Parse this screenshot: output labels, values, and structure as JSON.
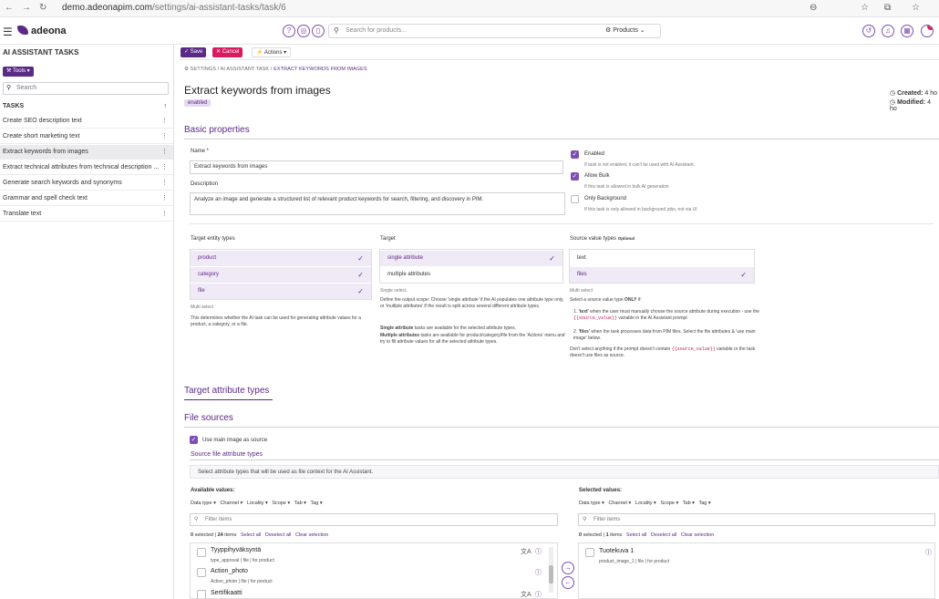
{
  "browser": {
    "url_domain": "demo.adeonapim.com",
    "url_path": "/settings/ai-assistant-tasks/task/6"
  },
  "header": {
    "brand": "adeona",
    "search_placeholder": "Search for products...",
    "search_scope": "Products",
    "notification_count": "6"
  },
  "sidebar": {
    "title": "AI ASSISTANT TASKS",
    "tools_label": "Tools",
    "search_placeholder": "Search",
    "tasks_header": "TASKS",
    "tasks": [
      "Create SEO description text",
      "Create short marketing text",
      "Extract keywords from images",
      "Extract technical attributes from technical description ...",
      "Generate search keywords and synonyms",
      "Grammar and spell check text",
      "Translate text"
    ]
  },
  "toolbar": {
    "save": "Save",
    "cancel": "Cancel",
    "actions": "Actions"
  },
  "breadcrumb": {
    "settings": "SETTINGS",
    "sep": "/",
    "ai": "AI ASSISTANT TASK",
    "current": "EXTRACT KEYWORDS FROM IMAGES"
  },
  "page": {
    "title": "Extract keywords from images",
    "status": "enabled",
    "created_label": "Created:",
    "created_value": "4 ho",
    "modified_label": "Modified:",
    "modified_value": "4 ho"
  },
  "basic": {
    "section_title": "Basic properties",
    "name_label": "Name *",
    "name_value": "Extract keywords from images",
    "desc_label": "Description",
    "desc_value": "Analyze an image and generate a structured list of relevant product keywords for search, filtering, and discovery in PIM.",
    "enabled_label": "Enabled",
    "enabled_hint": "If task is not enabled, it can't be used with AI Assistant.",
    "bulk_label": "Allow Bulk",
    "bulk_hint": "If this task is allowed in bulk AI generation",
    "bg_label": "Only Background",
    "bg_hint": "If this task is only allowed in background jobs, not via UI"
  },
  "target_entity": {
    "label": "Target entity types",
    "options": [
      "product",
      "category",
      "file"
    ],
    "mode": "Multi select",
    "help": "This determines whether the AI task can be used for generating attribute values for a product, a category, or a file."
  },
  "target": {
    "label": "Target",
    "options": [
      "single attribute",
      "multiple attributes"
    ],
    "mode": "Single select.",
    "help1": "Define the output scope: Choose 'single attribute' if the AI populates one attribute type only, or 'multiple attributes' if the result is split across several different attribute types.",
    "help2_bold": "Single attribute",
    "help2": " tasks are available for the selected attribute types.",
    "help3_bold": "Multiple attributes",
    "help3": " tasks are available for product/category/file from the 'Actions' menu and try to fill attribute values for all the selected attribute types."
  },
  "source_types": {
    "label": "Source value types",
    "optional": "Optional",
    "options": [
      "text",
      "files"
    ],
    "mode": "Multi select",
    "intro": "Select a source value type ",
    "intro_bold": "ONLY",
    "intro_end": " if:",
    "li1_a": "'text'",
    "li1_b": " when the user must manually choose the source attribute during execution - use the ",
    "li1_code": "{{source_value}}",
    "li1_c": " variable in the AI Assistant prompt",
    "li2_a": "'files'",
    "li2_b": " when the task processes data from PIM files. Select the file attributes & 'use main image' below.",
    "outro_a": "Don't select anything if the prompt doesn't contain ",
    "outro_code": "{{source_value}}",
    "outro_b": " variable or the task doesn't use files as source."
  },
  "sections": {
    "target_attr": "Target attribute types",
    "file_sources": "File sources"
  },
  "file_sources": {
    "use_main_label": "Use main image as source",
    "src_attr_title": "Source file attribute types",
    "src_attr_hint": "Select attribute types that will be used as file context for the AI Assistant.",
    "available_title": "Available values:",
    "selected_title": "Selected values:",
    "filters": [
      "Data type",
      "Channel",
      "Locality",
      "Scope",
      "Tab",
      "Tag"
    ],
    "filter_placeholder": "Filter items",
    "avail_selected_count": "0",
    "avail_selected_word": "selected",
    "avail_items_count": "24",
    "avail_items_word": "items",
    "sel_selected_count": "0",
    "sel_items_count": "1",
    "select_all": "Select all",
    "deselect_all": "Deselect all",
    "clear_selection": "Clear selection",
    "available_items": [
      {
        "name": "Tyyppihyväksyntä",
        "sub": "type_approval | file | for product"
      },
      {
        "name": "Action_photo",
        "sub": "Action_photo | file | for product"
      },
      {
        "name": "Sertifikaatti",
        "sub": ""
      }
    ],
    "selected_items": [
      {
        "name": "Tuotekuva 1",
        "sub": "product_image_1 | file | for product"
      }
    ]
  }
}
